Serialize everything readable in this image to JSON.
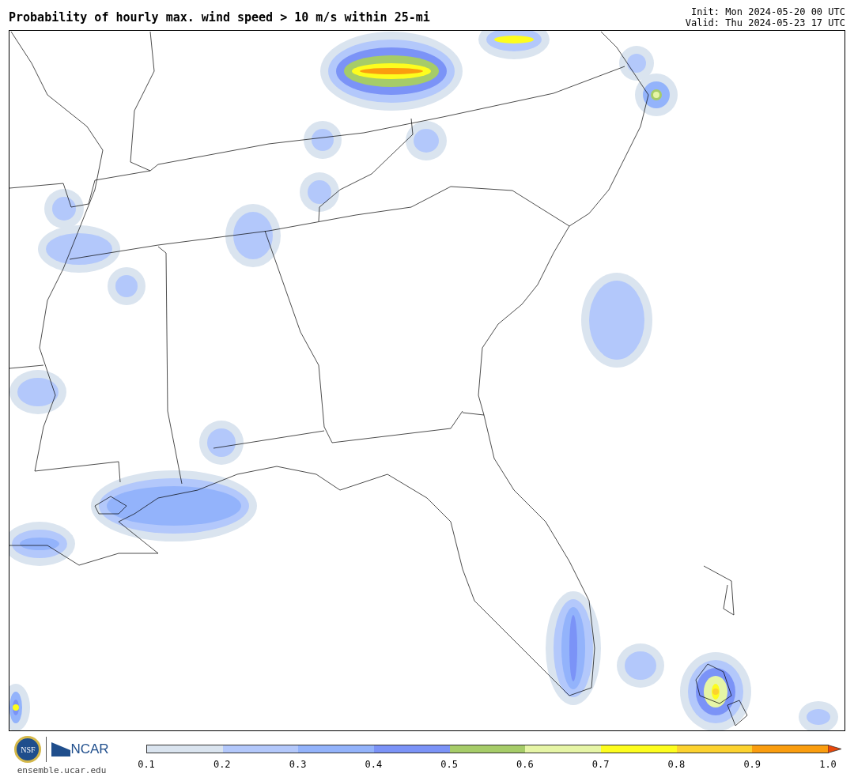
{
  "title": "Probability of hourly max. wind speed > 10 m/s within 25-mi",
  "init": "Init: Mon 2024-05-20 00 UTC",
  "valid": "Valid: Thu 2024-05-23 17 UTC",
  "logos": {
    "nsf_text": "NSF",
    "ncar_text": "NCAR",
    "site": "ensemble.ucar.edu"
  },
  "colorbar": {
    "bins": [
      {
        "color": "#dae4ef"
      },
      {
        "color": "#b3c8fb"
      },
      {
        "color": "#93b3fb"
      },
      {
        "color": "#7b93f7"
      },
      {
        "color": "#a6cc68"
      },
      {
        "color": "#e6f5a6"
      },
      {
        "color": "#fdfd1e"
      },
      {
        "color": "#fcd22f"
      },
      {
        "color": "#fa9d0f"
      }
    ],
    "extend": {
      "color": "#e8480a"
    },
    "ticks": [
      "0.1",
      "0.2",
      "0.3",
      "0.4",
      "0.5",
      "0.6",
      "0.7",
      "0.8",
      "0.9",
      "1.0"
    ]
  }
}
